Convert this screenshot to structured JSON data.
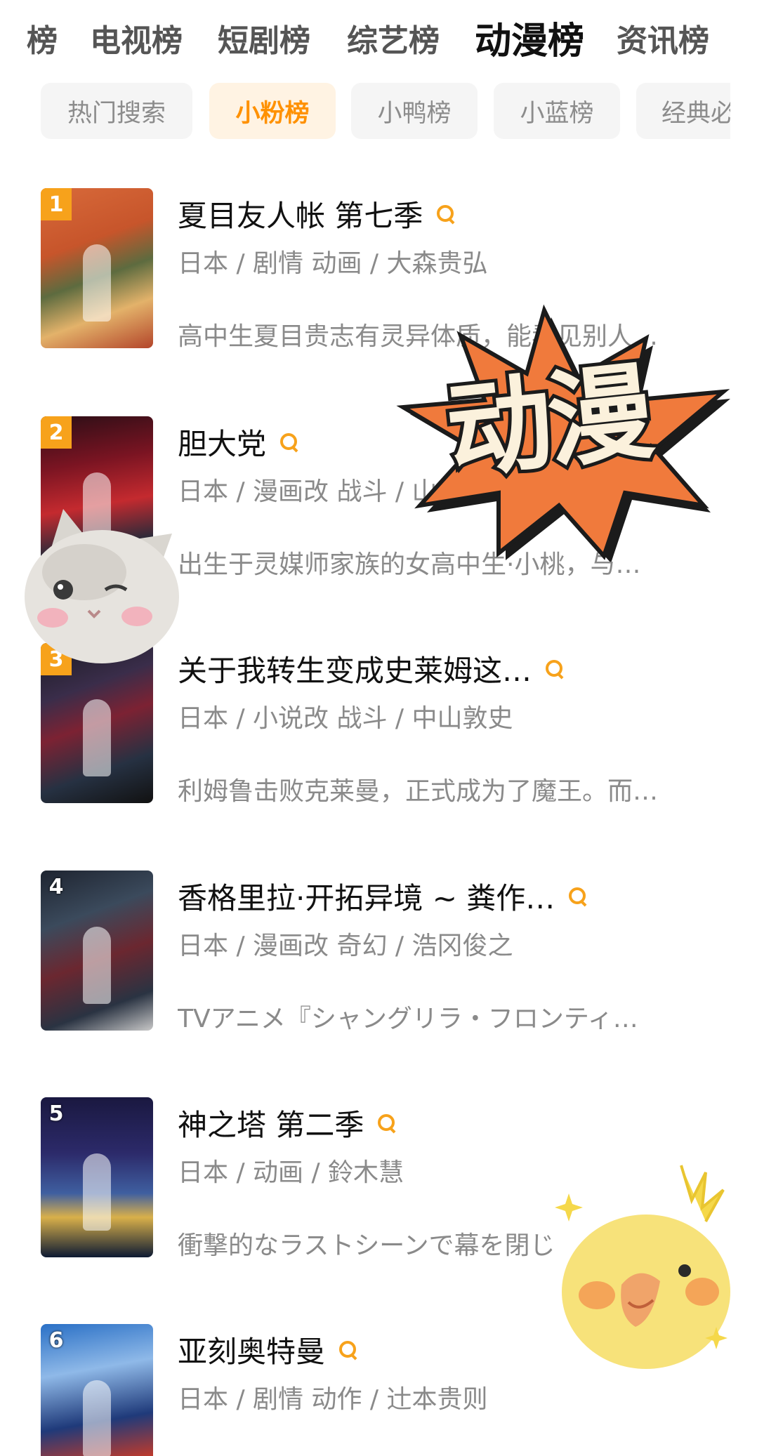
{
  "top_tabs": [
    {
      "label": "榜",
      "active": false
    },
    {
      "label": "电视榜",
      "active": false
    },
    {
      "label": "短剧榜",
      "active": false
    },
    {
      "label": "综艺榜",
      "active": false
    },
    {
      "label": "动漫榜",
      "active": true
    },
    {
      "label": "资讯榜",
      "active": false
    }
  ],
  "sub_tabs": [
    {
      "label": "热门搜索",
      "active": false
    },
    {
      "label": "小粉榜",
      "active": true
    },
    {
      "label": "小鸭榜",
      "active": false
    },
    {
      "label": "小蓝榜",
      "active": false
    },
    {
      "label": "经典必",
      "active": false
    }
  ],
  "items": [
    {
      "rank": "1",
      "title": "夏目友人帐 第七季",
      "meta": "日本 / 剧情 动画 / 大森贵弘",
      "desc": "高中生夏目贵志有灵异体质，能看见别人…"
    },
    {
      "rank": "2",
      "title": "胆大党",
      "meta": "日本 / 漫画改 战斗 / 山",
      "desc": "出生于灵媒师家族的女高中生·小桃，与…"
    },
    {
      "rank": "3",
      "title": "关于我转生变成史莱姆这…",
      "meta": "日本 / 小说改 战斗 / 中山敦史",
      "desc": "利姆鲁击败克莱曼，正式成为了魔王。而…"
    },
    {
      "rank": "4",
      "title": "香格里拉·开拓异境 ~ 粪作…",
      "meta": "日本 / 漫画改 奇幻 / 浩冈俊之",
      "desc": "TVアニメ『シャングリラ・フロンティ…"
    },
    {
      "rank": "5",
      "title": "神之塔 第二季",
      "meta": "日本 / 动画 / 鈴木慧",
      "desc": "衝撃的なラストシーンで幕を閉じ"
    },
    {
      "rank": "6",
      "title": "亚刻奥特曼",
      "meta": "日本 / 剧情 动作 / 辻本贵则",
      "desc": ""
    }
  ],
  "sticker": {
    "text": "动漫"
  },
  "colors": {
    "accent": "#ff9100",
    "rank_badge": "#f7a21b",
    "burst": "#f07a3c"
  }
}
